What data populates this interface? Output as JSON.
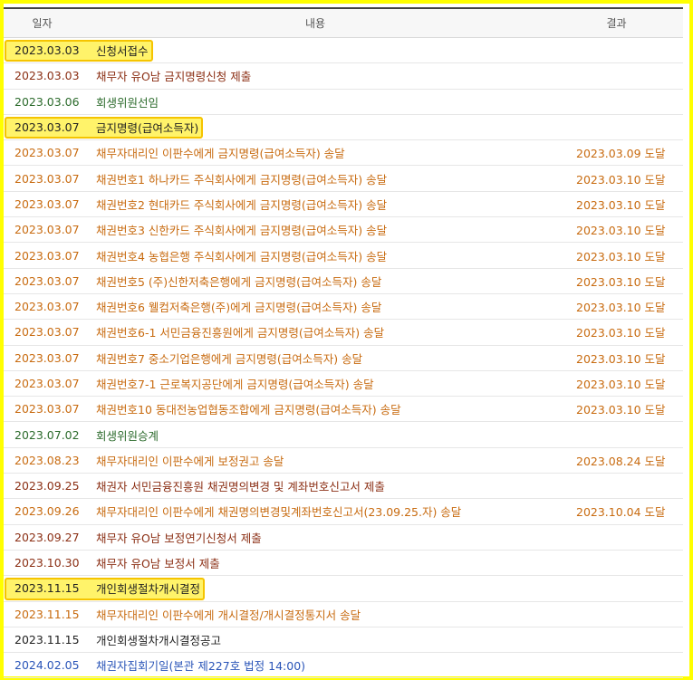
{
  "header": {
    "date": "일자",
    "content": "내용",
    "result": "결과"
  },
  "rows": [
    {
      "date": "2023.03.03",
      "content": "신청서접수",
      "result": "",
      "color": "c-black",
      "highlight": true
    },
    {
      "date": "2023.03.03",
      "content": "채무자 유O남 금지명령신청 제출",
      "result": "",
      "color": "c-brown"
    },
    {
      "date": "2023.03.06",
      "content": "회생위원선임",
      "result": "",
      "color": "c-green"
    },
    {
      "date": "2023.03.07",
      "content": "금지명령(급여소득자)",
      "result": "",
      "color": "c-black",
      "highlight": true
    },
    {
      "date": "2023.03.07",
      "content": "채무자대리인 이판수에게 금지명령(급여소득자) 송달",
      "result": "2023.03.09 도달",
      "color": "c-orange"
    },
    {
      "date": "2023.03.07",
      "content": "채권번호1 하나카드 주식회사에게 금지명령(급여소득자) 송달",
      "result": "2023.03.10 도달",
      "color": "c-orange"
    },
    {
      "date": "2023.03.07",
      "content": "채권번호2 현대카드 주식회사에게 금지명령(급여소득자) 송달",
      "result": "2023.03.10 도달",
      "color": "c-orange"
    },
    {
      "date": "2023.03.07",
      "content": "채권번호3 신한카드 주식회사에게 금지명령(급여소득자) 송달",
      "result": "2023.03.10 도달",
      "color": "c-orange"
    },
    {
      "date": "2023.03.07",
      "content": "채권번호4 농협은행 주식회사에게 금지명령(급여소득자) 송달",
      "result": "2023.03.10 도달",
      "color": "c-orange"
    },
    {
      "date": "2023.03.07",
      "content": "채권번호5 (주)신한저축은행에게 금지명령(급여소득자) 송달",
      "result": "2023.03.10 도달",
      "color": "c-orange"
    },
    {
      "date": "2023.03.07",
      "content": "채권번호6 웰컴저축은행(주)에게 금지명령(급여소득자) 송달",
      "result": "2023.03.10 도달",
      "color": "c-orange"
    },
    {
      "date": "2023.03.07",
      "content": "채권번호6-1 서민금융진흥원에게 금지명령(급여소득자) 송달",
      "result": "2023.03.10 도달",
      "color": "c-orange"
    },
    {
      "date": "2023.03.07",
      "content": "채권번호7 중소기업은행에게 금지명령(급여소득자) 송달",
      "result": "2023.03.10 도달",
      "color": "c-orange"
    },
    {
      "date": "2023.03.07",
      "content": "채권번호7-1 근로복지공단에게 금지명령(급여소득자) 송달",
      "result": "2023.03.10 도달",
      "color": "c-orange"
    },
    {
      "date": "2023.03.07",
      "content": "채권번호10 동대전농업협동조합에게 금지명령(급여소득자) 송달",
      "result": "2023.03.10 도달",
      "color": "c-orange"
    },
    {
      "date": "2023.07.02",
      "content": "회생위원승계",
      "result": "",
      "color": "c-green"
    },
    {
      "date": "2023.08.23",
      "content": "채무자대리인 이판수에게 보정권고 송달",
      "result": "2023.08.24 도달",
      "color": "c-orange"
    },
    {
      "date": "2023.09.25",
      "content": "채권자 서민금융진흥원 채권명의변경 및 계좌번호신고서 제출",
      "result": "",
      "color": "c-brown"
    },
    {
      "date": "2023.09.26",
      "content": "채무자대리인 이판수에게 채권명의변경및계좌번호신고서(23.09.25.자) 송달",
      "result": "2023.10.04 도달",
      "color": "c-orange"
    },
    {
      "date": "2023.09.27",
      "content": "채무자 유O남 보정연기신청서 제출",
      "result": "",
      "color": "c-brown"
    },
    {
      "date": "2023.10.30",
      "content": "채무자 유O남 보정서 제출",
      "result": "",
      "color": "c-brown"
    },
    {
      "date": "2023.11.15",
      "content": "개인회생절차개시결정",
      "result": "",
      "color": "c-black",
      "highlight": true
    },
    {
      "date": "2023.11.15",
      "content": "채무자대리인 이판수에게 개시결정/개시결정통지서 송달",
      "result": "",
      "color": "c-orange"
    },
    {
      "date": "2023.11.15",
      "content": "개인회생절차개시결정공고",
      "result": "",
      "color": "c-black"
    },
    {
      "date": "2024.02.05",
      "content": "채권자집회기일(본관 제227호 법정 14:00)",
      "result": "",
      "color": "c-blue"
    }
  ]
}
